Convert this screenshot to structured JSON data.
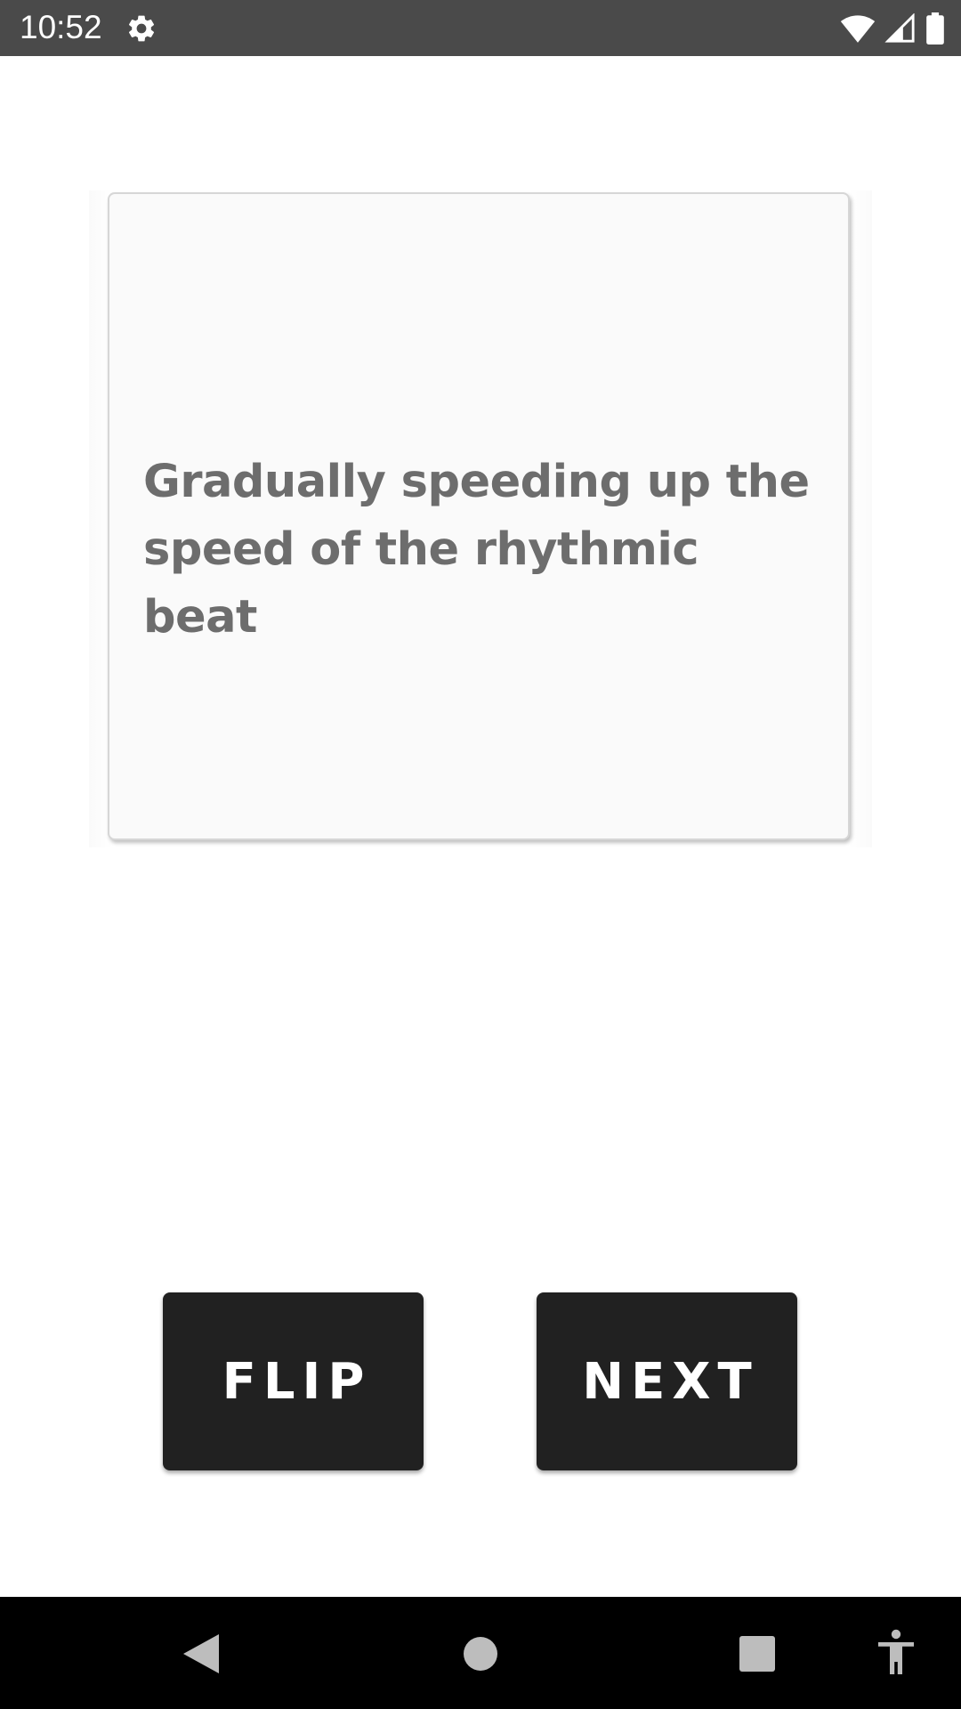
{
  "status_bar": {
    "time": "10:52",
    "icons": [
      "settings-gear-icon",
      "wifi-icon",
      "cellular-signal-icon",
      "battery-icon"
    ]
  },
  "card": {
    "text": "Gradually speeding up the speed of the rhythmic beat"
  },
  "buttons": {
    "flip_label": "FLIP",
    "next_label": "NEXT"
  },
  "nav_bar": {
    "icons": [
      "back-icon",
      "home-icon",
      "recents-icon",
      "accessibility-icon"
    ]
  },
  "colors": {
    "status_bar_bg": "#4a4a4a",
    "card_bg": "#fafafa",
    "card_text": "#6d6d6d",
    "button_bg": "#212121",
    "button_text": "#ffffff",
    "nav_bar_bg": "#000000"
  }
}
